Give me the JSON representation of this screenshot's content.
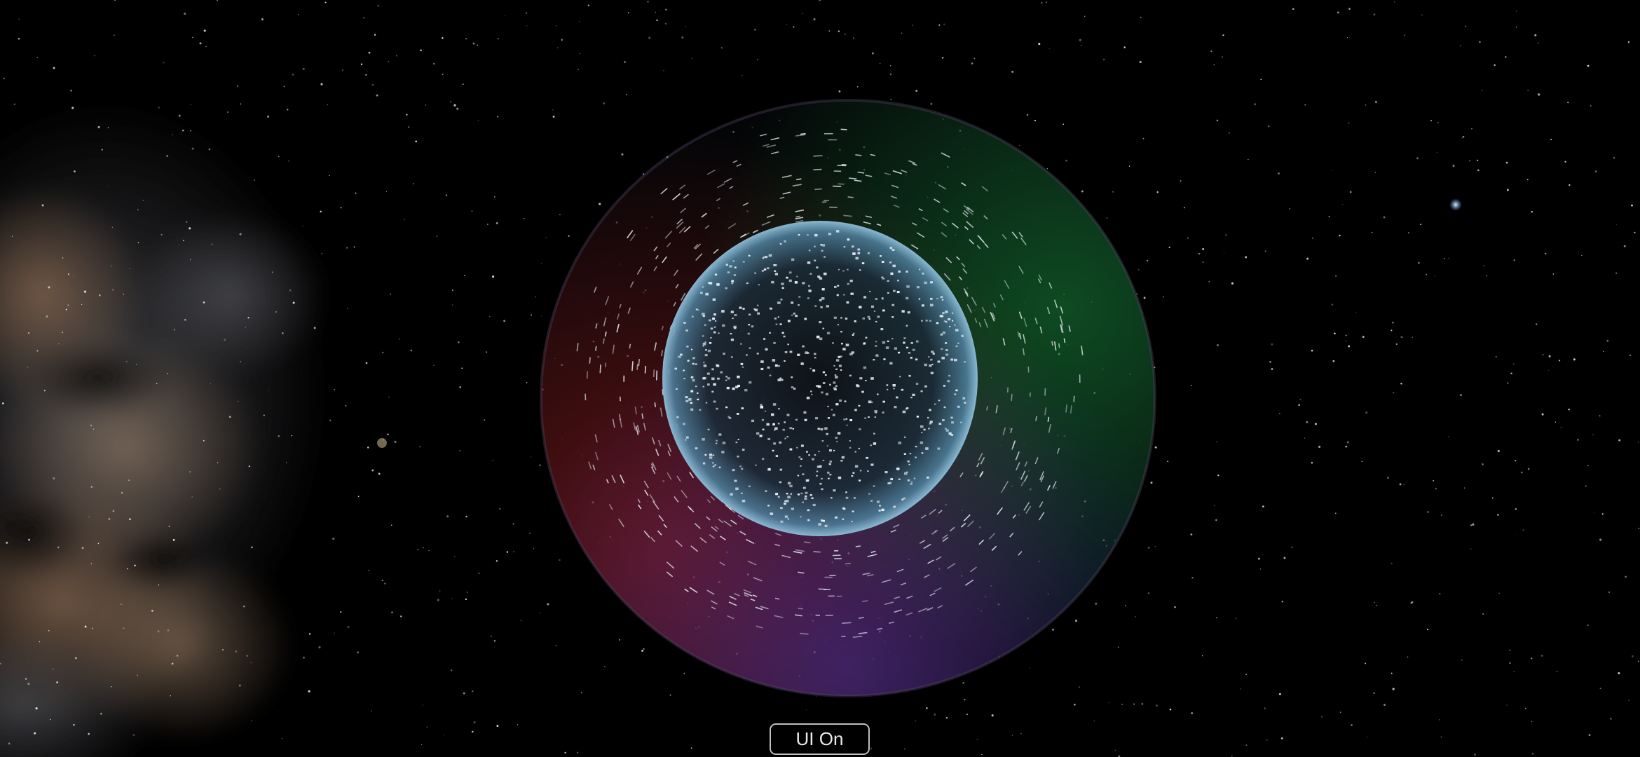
{
  "scene": {
    "background_color": "#000000",
    "outer_shell_tints": [
      "#ff2a2a",
      "#2aff6a",
      "#5a4bff"
    ],
    "inner_sphere_color": "#6fa8c8",
    "particle_color": "#e6eef4",
    "nebula_colors": [
      "#8a6a52",
      "#a88a70",
      "#5e5f66"
    ]
  },
  "ui": {
    "toggle_label": "UI On"
  }
}
